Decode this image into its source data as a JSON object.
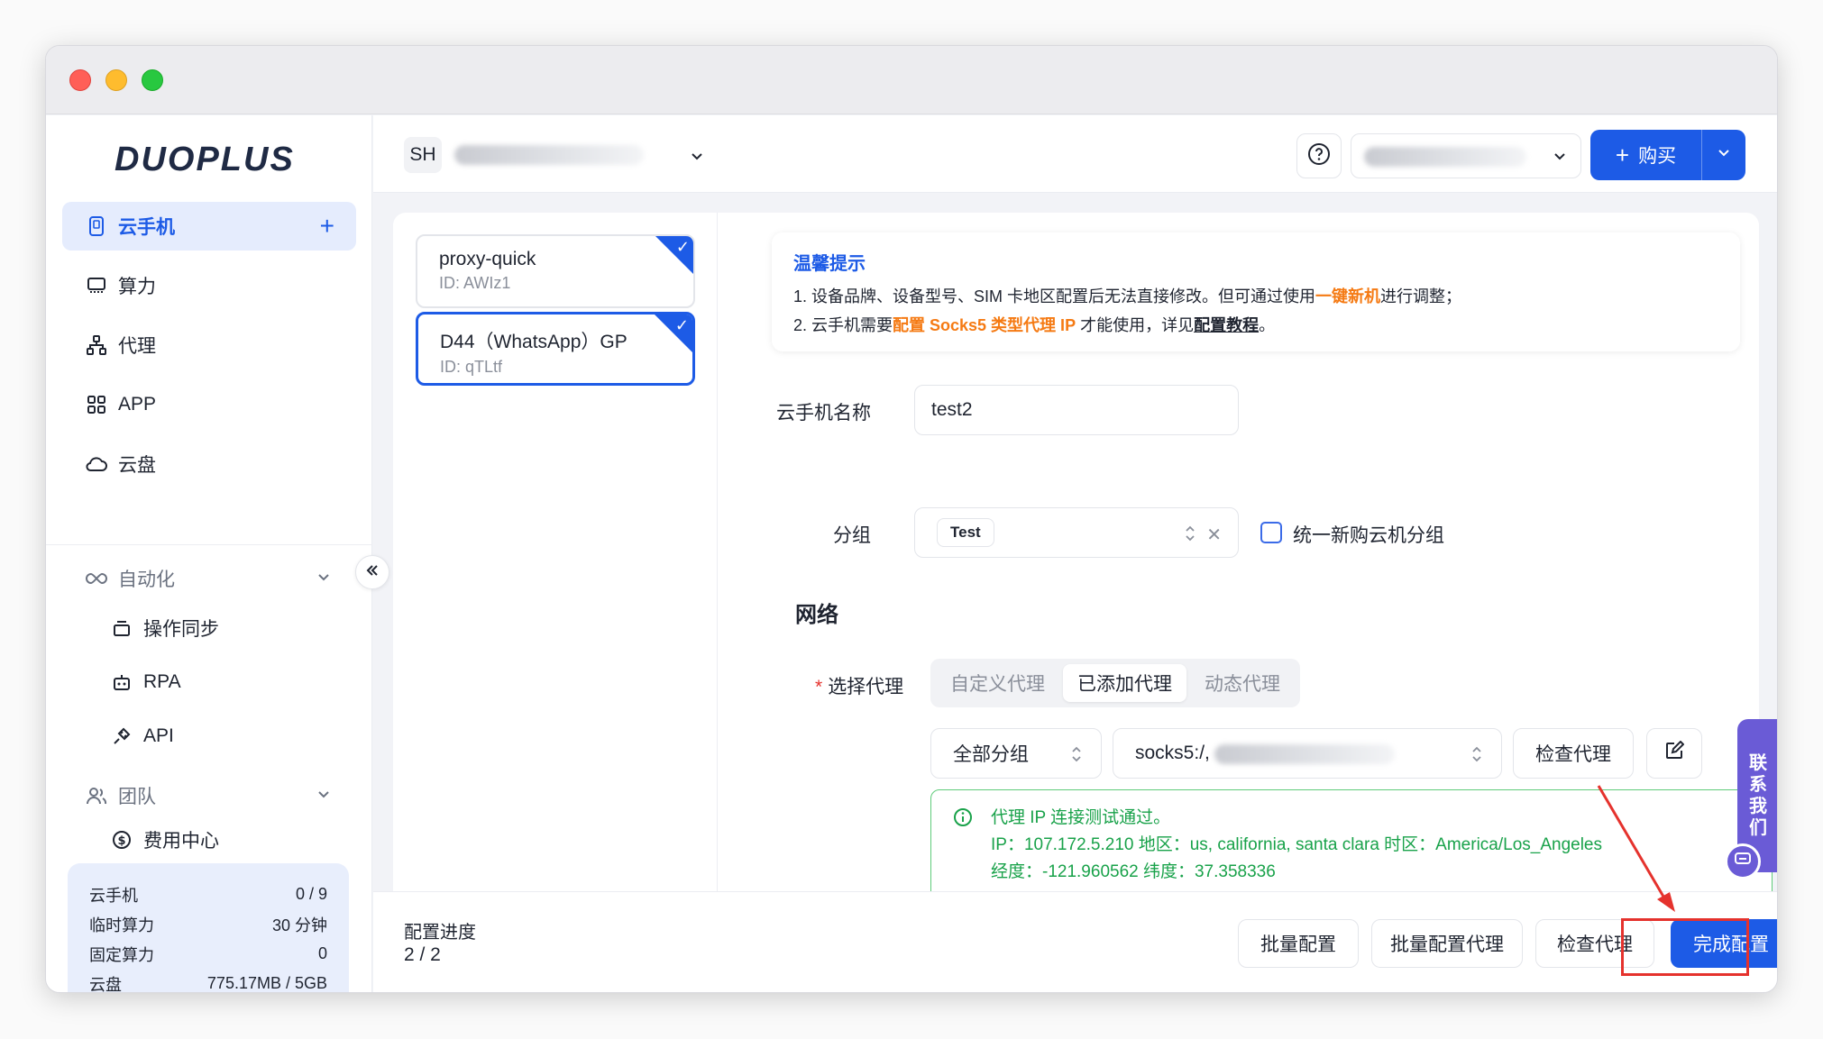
{
  "app": {
    "logo_text": "DUOPLUS"
  },
  "sidebar": {
    "items": [
      {
        "label": "云手机",
        "active": true
      },
      {
        "label": "算力"
      },
      {
        "label": "代理"
      },
      {
        "label": "APP"
      },
      {
        "label": "云盘"
      }
    ],
    "automation": {
      "label": "自动化",
      "children": [
        "操作同步",
        "RPA",
        "API"
      ]
    },
    "team": {
      "label": "团队",
      "children": [
        "费用中心"
      ]
    },
    "stats": [
      {
        "label": "云手机",
        "value": "0 / 9"
      },
      {
        "label": "临时算力",
        "value": "30 分钟"
      },
      {
        "label": "固定算力",
        "value": "0"
      },
      {
        "label": "云盘",
        "value": "775.17MB / 5GB"
      }
    ]
  },
  "topbar": {
    "workspace_badge": "SH",
    "buy_label": "购买"
  },
  "devices": [
    {
      "name": "proxy-quick",
      "id": "ID: AWIz1",
      "checked": true,
      "selected": false
    },
    {
      "name": "D44（WhatsApp）GP",
      "id": "ID: qTLtf",
      "checked": true,
      "selected": true
    }
  ],
  "tip": {
    "title": "温馨提示",
    "line1_a": "1. 设备品牌、设备型号、SIM 卡地区配置后无法直接修改。但可通过使用",
    "line1_link": "一键新机",
    "line1_b": "进行调整；",
    "line2_a": "2. 云手机需要",
    "line2_link": "配置 Socks5 类型代理 IP",
    "line2_b": " 才能使用，详见",
    "line2_link2": "配置教程",
    "line2_c": "。"
  },
  "form": {
    "name_label": "云手机名称",
    "name_value": "test2",
    "group_label": "分组",
    "group_tag": "Test",
    "unify_group_label": "统一新购云机分组",
    "network_title": "网络",
    "proxy_label": "选择代理",
    "required_mark": "*",
    "proxy_tabs": [
      "自定义代理",
      "已添加代理",
      "动态代理"
    ],
    "proxy_tab_active": 1,
    "group_filter": "全部分组",
    "proxy_value": "socks5:/,",
    "check_proxy_label": "检查代理"
  },
  "result": {
    "line1": "代理 IP 连接测试通过。",
    "line2": "IP：107.172.5.210  地区：us, california, santa clara  时区：America/Los_Angeles",
    "line3": "经度：-121.960562  纬度：37.358336"
  },
  "footer": {
    "progress_label": "配置进度",
    "progress_value": "2 / 2",
    "buttons": [
      "批量配置",
      "批量配置代理",
      "检查代理",
      "完成配置"
    ]
  },
  "contact": {
    "chars": [
      "联",
      "系",
      "我",
      "们"
    ]
  },
  "colors": {
    "accent": "#1d5be6",
    "success": "#19a24a",
    "highlight": "#f57a13",
    "annotation": "#e5322d"
  }
}
